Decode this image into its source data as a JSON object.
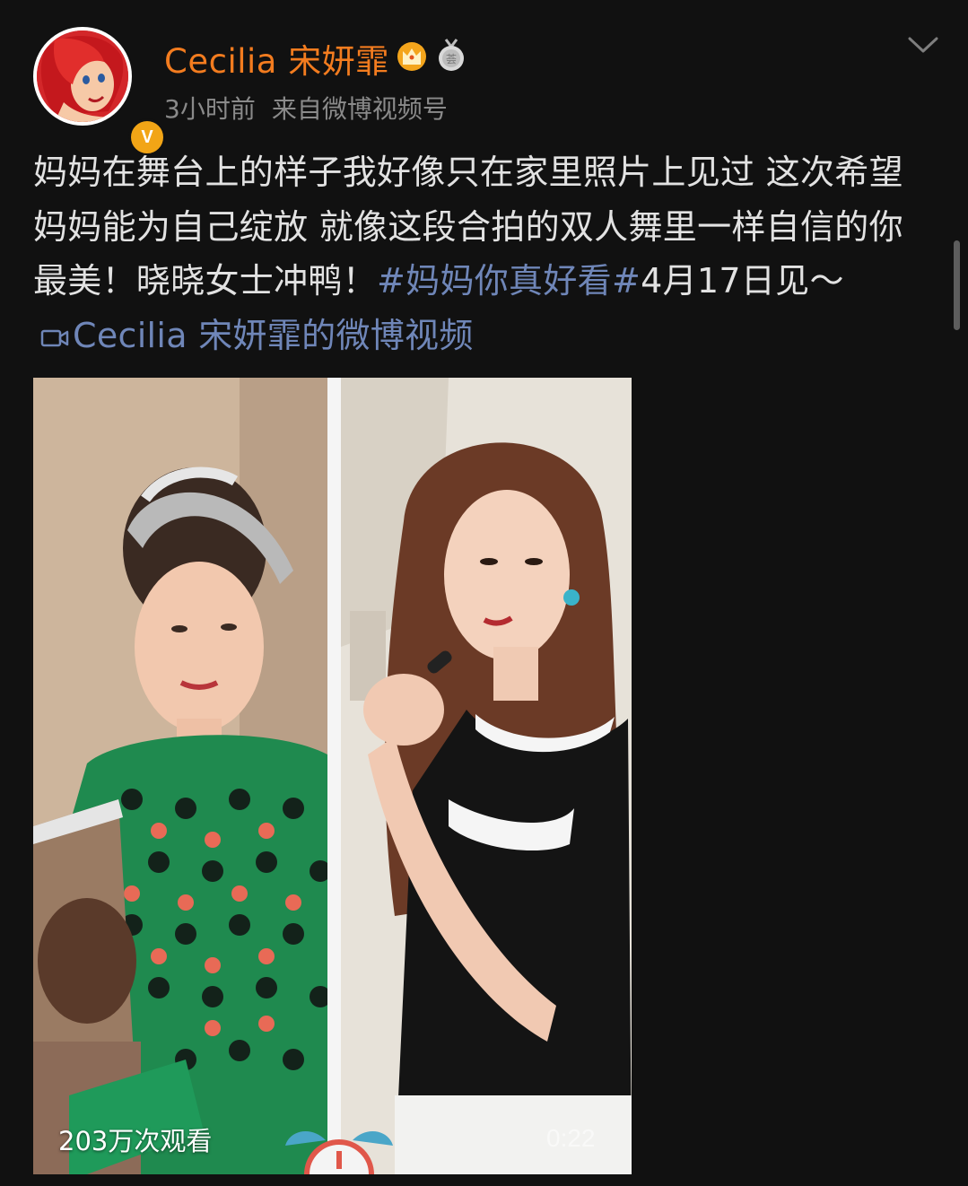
{
  "post": {
    "user_name": "Cecilia 宋妍霏",
    "time": "3小时前",
    "source": "来自微博视频号",
    "text_main": "妈妈在舞台上的样子我好像只在家里照片上见过 这次希望妈妈能为自己绽放 就像这段合拍的双人舞里一样自信的你最美！晓晓女士冲鸭！",
    "hashtag": "#妈妈你真好看#",
    "text_after": "4月17日见～",
    "video_link_label": "Cecilia 宋妍霏的微博视频"
  },
  "video": {
    "view_count": "203万次观看",
    "duration": "0:22"
  },
  "icons": {
    "avatar": "avatar",
    "verified": "verified-badge-icon",
    "verified_letter": "V",
    "crown": "crown-icon",
    "medal": "medal-icon",
    "menu": "chevron-down-icon",
    "video_link": "video-camera-icon",
    "alarm": "alarm-clock-icon"
  },
  "colors": {
    "background": "#111111",
    "username": "#f37c1f",
    "link": "#6f86b8",
    "meta": "#8a8a8a",
    "verified_badge": "#f2a516"
  }
}
